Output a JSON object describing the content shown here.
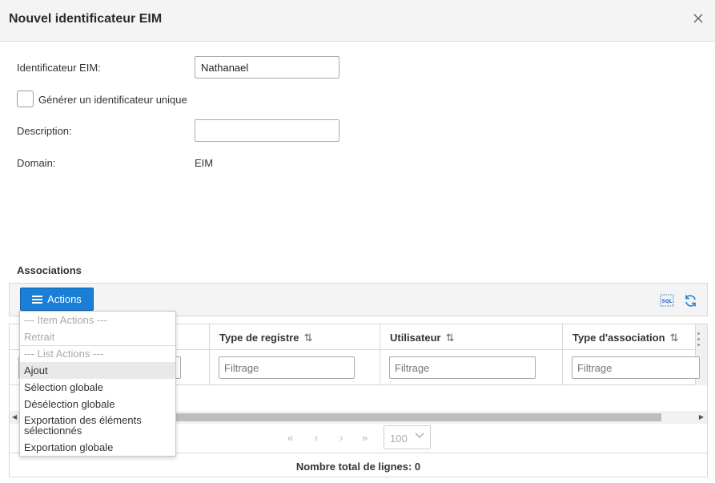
{
  "dialog": {
    "title": "Nouvel identificateur EIM",
    "close_icon": "close-icon"
  },
  "form": {
    "eim_label": "Identificateur EIM:",
    "eim_value": "Nathanael",
    "unique_label": "Générer un identificateur unique",
    "unique_checked": false,
    "description_label": "Description:",
    "description_value": "",
    "domain_label": "Domain:",
    "domain_value": "EIM"
  },
  "associations": {
    "title": "Associations",
    "actions_label": "Actions",
    "sql_icon": "sql-icon",
    "refresh_icon": "refresh-icon",
    "columns": [
      {
        "label": "Type de registre",
        "filter_placeholder": "Filtrage"
      },
      {
        "label": "Utilisateur",
        "filter_placeholder": "Filtrage"
      },
      {
        "label": "Type d'association",
        "filter_placeholder": "Filtrage"
      }
    ],
    "sort_icon": "⇅",
    "pager": {
      "first": "«",
      "prev": "‹",
      "next": "›",
      "last": "»",
      "page_size": "100"
    },
    "total_label": "Nombre total de lignes: 0"
  },
  "dropdown": {
    "item_actions_header": "--- Item Actions ---",
    "retrait": "Retrait",
    "list_actions_header": "--- List Actions ---",
    "ajout": "Ajout",
    "selection_globale": "Sélection globale",
    "deselection_globale": "Désélection globale",
    "exportation_selection_line1": "Exportation des éléments",
    "exportation_selection_line2": "sélectionnés",
    "exportation_globale": "Exportation globale"
  },
  "colors": {
    "accent": "#1a7fd6",
    "header_bg": "#f4f4f4"
  }
}
